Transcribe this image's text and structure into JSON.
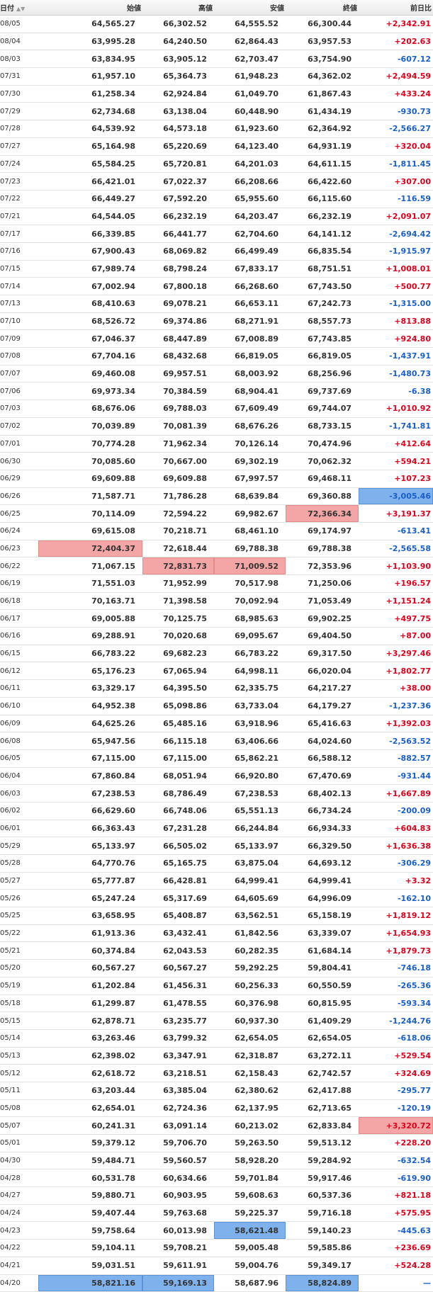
{
  "headers": {
    "date": "日付",
    "open": "始値",
    "high": "高値",
    "low": "安値",
    "close": "終値",
    "change": "前日比"
  },
  "colors": {
    "positive": "#e0001b",
    "negative": "#1a5fc8",
    "highlight_red": "#f4a6a6",
    "highlight_blue": "#7fb1ec"
  },
  "rows": [
    {
      "date": "08/05",
      "open": "64,565.27",
      "high": "66,302.52",
      "low": "64,555.52",
      "close": "66,300.44",
      "change": "+2,342.91"
    },
    {
      "date": "08/04",
      "open": "63,995.28",
      "high": "64,240.50",
      "low": "62,864.43",
      "close": "63,957.53",
      "change": "+202.63"
    },
    {
      "date": "08/03",
      "open": "63,834.95",
      "high": "63,905.12",
      "low": "62,703.47",
      "close": "63,754.90",
      "change": "-607.12"
    },
    {
      "date": "07/31",
      "open": "61,957.10",
      "high": "65,364.73",
      "low": "61,948.23",
      "close": "64,362.02",
      "change": "+2,494.59"
    },
    {
      "date": "07/30",
      "open": "61,258.34",
      "high": "62,924.84",
      "low": "61,049.70",
      "close": "61,867.43",
      "change": "+433.24"
    },
    {
      "date": "07/29",
      "open": "62,734.68",
      "high": "63,138.04",
      "low": "60,448.90",
      "close": "61,434.19",
      "change": "-930.73"
    },
    {
      "date": "07/28",
      "open": "64,539.92",
      "high": "64,573.18",
      "low": "61,923.60",
      "close": "62,364.92",
      "change": "-2,566.27"
    },
    {
      "date": "07/27",
      "open": "65,164.98",
      "high": "65,220.69",
      "low": "64,123.40",
      "close": "64,931.19",
      "change": "+320.04"
    },
    {
      "date": "07/24",
      "open": "65,584.25",
      "high": "65,720.81",
      "low": "64,201.03",
      "close": "64,611.15",
      "change": "-1,811.45"
    },
    {
      "date": "07/23",
      "open": "66,421.01",
      "high": "67,022.37",
      "low": "66,208.66",
      "close": "66,422.60",
      "change": "+307.00"
    },
    {
      "date": "07/22",
      "open": "66,449.27",
      "high": "67,592.20",
      "low": "65,955.60",
      "close": "66,115.60",
      "change": "-116.59"
    },
    {
      "date": "07/21",
      "open": "64,544.05",
      "high": "66,232.19",
      "low": "64,203.47",
      "close": "66,232.19",
      "change": "+2,091.07"
    },
    {
      "date": "07/17",
      "open": "66,339.85",
      "high": "66,441.77",
      "low": "62,704.60",
      "close": "64,141.12",
      "change": "-2,694.42"
    },
    {
      "date": "07/16",
      "open": "67,900.43",
      "high": "68,069.82",
      "low": "66,499.49",
      "close": "66,835.54",
      "change": "-1,915.97"
    },
    {
      "date": "07/15",
      "open": "67,989.74",
      "high": "68,798.24",
      "low": "67,833.17",
      "close": "68,751.51",
      "change": "+1,008.01"
    },
    {
      "date": "07/14",
      "open": "67,002.94",
      "high": "67,800.18",
      "low": "66,268.60",
      "close": "67,743.50",
      "change": "+500.77"
    },
    {
      "date": "07/13",
      "open": "68,410.63",
      "high": "69,078.21",
      "low": "66,653.11",
      "close": "67,242.73",
      "change": "-1,315.00"
    },
    {
      "date": "07/10",
      "open": "68,526.72",
      "high": "69,374.86",
      "low": "68,271.91",
      "close": "68,557.73",
      "change": "+813.88"
    },
    {
      "date": "07/09",
      "open": "67,046.37",
      "high": "68,447.89",
      "low": "67,008.89",
      "close": "67,743.85",
      "change": "+924.80"
    },
    {
      "date": "07/08",
      "open": "67,704.16",
      "high": "68,432.68",
      "low": "66,819.05",
      "close": "66,819.05",
      "change": "-1,437.91"
    },
    {
      "date": "07/07",
      "open": "69,460.08",
      "high": "69,957.51",
      "low": "68,003.92",
      "close": "68,256.96",
      "change": "-1,480.73"
    },
    {
      "date": "07/06",
      "open": "69,973.34",
      "high": "70,384.59",
      "low": "68,904.41",
      "close": "69,737.69",
      "change": "-6.38"
    },
    {
      "date": "07/03",
      "open": "68,676.06",
      "high": "69,788.03",
      "low": "67,609.49",
      "close": "69,744.07",
      "change": "+1,010.92"
    },
    {
      "date": "07/02",
      "open": "70,039.89",
      "high": "70,081.39",
      "low": "68,676.26",
      "close": "68,733.15",
      "change": "-1,741.81"
    },
    {
      "date": "07/01",
      "open": "70,774.28",
      "high": "71,962.34",
      "low": "70,126.14",
      "close": "70,474.96",
      "change": "+412.64"
    },
    {
      "date": "06/30",
      "open": "70,085.60",
      "high": "70,667.00",
      "low": "69,302.19",
      "close": "70,062.32",
      "change": "+594.21"
    },
    {
      "date": "06/29",
      "open": "69,609.88",
      "high": "69,609.88",
      "low": "67,997.57",
      "close": "69,468.11",
      "change": "+107.23"
    },
    {
      "date": "06/26",
      "open": "71,587.71",
      "high": "71,786.28",
      "low": "68,639.84",
      "close": "69,360.88",
      "change": "-3,005.46",
      "hl_change": "blue"
    },
    {
      "date": "06/25",
      "open": "70,114.09",
      "high": "72,594.22",
      "low": "69,982.67",
      "close": "72,366.34",
      "change": "+3,191.37",
      "hl_close": "red"
    },
    {
      "date": "06/24",
      "open": "69,615.08",
      "high": "70,218.71",
      "low": "68,461.10",
      "close": "69,174.97",
      "change": "-613.41"
    },
    {
      "date": "06/23",
      "open": "72,404.37",
      "high": "72,618.44",
      "low": "69,788.38",
      "close": "69,788.38",
      "change": "-2,565.58",
      "hl_open": "red"
    },
    {
      "date": "06/22",
      "open": "71,067.15",
      "high": "72,831.73",
      "low": "71,009.52",
      "close": "72,353.96",
      "change": "+1,103.90",
      "hl_high": "red",
      "hl_low": "red"
    },
    {
      "date": "06/19",
      "open": "71,551.03",
      "high": "71,952.99",
      "low": "70,517.98",
      "close": "71,250.06",
      "change": "+196.57"
    },
    {
      "date": "06/18",
      "open": "70,163.71",
      "high": "71,398.58",
      "low": "70,092.94",
      "close": "71,053.49",
      "change": "+1,151.24"
    },
    {
      "date": "06/17",
      "open": "69,005.88",
      "high": "70,125.75",
      "low": "68,985.63",
      "close": "69,902.25",
      "change": "+497.75"
    },
    {
      "date": "06/16",
      "open": "69,288.91",
      "high": "70,020.68",
      "low": "69,095.67",
      "close": "69,404.50",
      "change": "+87.00"
    },
    {
      "date": "06/15",
      "open": "66,783.22",
      "high": "69,682.23",
      "low": "66,783.22",
      "close": "69,317.50",
      "change": "+3,297.46"
    },
    {
      "date": "06/12",
      "open": "65,176.23",
      "high": "67,065.94",
      "low": "64,998.11",
      "close": "66,020.04",
      "change": "+1,802.77"
    },
    {
      "date": "06/11",
      "open": "63,329.17",
      "high": "64,395.50",
      "low": "62,335.75",
      "close": "64,217.27",
      "change": "+38.00"
    },
    {
      "date": "06/10",
      "open": "64,952.38",
      "high": "65,098.86",
      "low": "63,733.04",
      "close": "64,179.27",
      "change": "-1,237.36"
    },
    {
      "date": "06/09",
      "open": "64,625.26",
      "high": "65,485.16",
      "low": "63,918.96",
      "close": "65,416.63",
      "change": "+1,392.03"
    },
    {
      "date": "06/08",
      "open": "65,947.56",
      "high": "66,115.18",
      "low": "63,406.66",
      "close": "64,024.60",
      "change": "-2,563.52"
    },
    {
      "date": "06/05",
      "open": "67,115.00",
      "high": "67,115.00",
      "low": "65,862.21",
      "close": "66,588.12",
      "change": "-882.57"
    },
    {
      "date": "06/04",
      "open": "67,860.84",
      "high": "68,051.94",
      "low": "66,920.80",
      "close": "67,470.69",
      "change": "-931.44"
    },
    {
      "date": "06/03",
      "open": "67,238.53",
      "high": "68,786.49",
      "low": "67,238.53",
      "close": "68,402.13",
      "change": "+1,667.89"
    },
    {
      "date": "06/02",
      "open": "66,629.60",
      "high": "66,748.06",
      "low": "65,551.13",
      "close": "66,734.24",
      "change": "-200.09"
    },
    {
      "date": "06/01",
      "open": "66,363.43",
      "high": "67,231.28",
      "low": "66,244.84",
      "close": "66,934.33",
      "change": "+604.83"
    },
    {
      "date": "05/29",
      "open": "65,133.97",
      "high": "66,505.02",
      "low": "65,133.97",
      "close": "66,329.50",
      "change": "+1,636.38"
    },
    {
      "date": "05/28",
      "open": "64,770.76",
      "high": "65,165.75",
      "low": "63,875.04",
      "close": "64,693.12",
      "change": "-306.29"
    },
    {
      "date": "05/27",
      "open": "65,777.87",
      "high": "66,428.81",
      "low": "64,999.41",
      "close": "64,999.41",
      "change": "+3.32"
    },
    {
      "date": "05/26",
      "open": "65,247.24",
      "high": "65,317.69",
      "low": "64,605.69",
      "close": "64,996.09",
      "change": "-162.10"
    },
    {
      "date": "05/25",
      "open": "63,658.95",
      "high": "65,408.87",
      "low": "63,562.51",
      "close": "65,158.19",
      "change": "+1,819.12"
    },
    {
      "date": "05/22",
      "open": "61,913.36",
      "high": "63,432.41",
      "low": "61,842.56",
      "close": "63,339.07",
      "change": "+1,654.93"
    },
    {
      "date": "05/21",
      "open": "60,374.84",
      "high": "62,043.53",
      "low": "60,282.35",
      "close": "61,684.14",
      "change": "+1,879.73"
    },
    {
      "date": "05/20",
      "open": "60,567.27",
      "high": "60,567.27",
      "low": "59,292.25",
      "close": "59,804.41",
      "change": "-746.18"
    },
    {
      "date": "05/19",
      "open": "61,202.84",
      "high": "61,456.31",
      "low": "60,256.33",
      "close": "60,550.59",
      "change": "-265.36"
    },
    {
      "date": "05/18",
      "open": "61,299.87",
      "high": "61,478.55",
      "low": "60,376.98",
      "close": "60,815.95",
      "change": "-593.34"
    },
    {
      "date": "05/15",
      "open": "62,878.71",
      "high": "63,235.77",
      "low": "60,937.30",
      "close": "61,409.29",
      "change": "-1,244.76"
    },
    {
      "date": "05/14",
      "open": "63,263.46",
      "high": "63,799.32",
      "low": "62,654.05",
      "close": "62,654.05",
      "change": "-618.06"
    },
    {
      "date": "05/13",
      "open": "62,398.02",
      "high": "63,347.91",
      "low": "62,318.87",
      "close": "63,272.11",
      "change": "+529.54"
    },
    {
      "date": "05/12",
      "open": "62,618.72",
      "high": "63,218.51",
      "low": "62,158.43",
      "close": "62,742.57",
      "change": "+324.69"
    },
    {
      "date": "05/11",
      "open": "63,203.44",
      "high": "63,385.04",
      "low": "62,380.62",
      "close": "62,417.88",
      "change": "-295.77"
    },
    {
      "date": "05/08",
      "open": "62,654.01",
      "high": "62,724.36",
      "low": "62,137.95",
      "close": "62,713.65",
      "change": "-120.19"
    },
    {
      "date": "05/07",
      "open": "60,241.31",
      "high": "63,091.14",
      "low": "60,213.02",
      "close": "62,833.84",
      "change": "+3,320.72",
      "hl_change": "red"
    },
    {
      "date": "05/01",
      "open": "59,379.12",
      "high": "59,706.70",
      "low": "59,263.50",
      "close": "59,513.12",
      "change": "+228.20"
    },
    {
      "date": "04/30",
      "open": "59,484.71",
      "high": "59,560.57",
      "low": "58,928.20",
      "close": "59,284.92",
      "change": "-632.54"
    },
    {
      "date": "04/28",
      "open": "60,531.78",
      "high": "60,634.66",
      "low": "59,701.84",
      "close": "59,917.46",
      "change": "-619.90"
    },
    {
      "date": "04/27",
      "open": "59,880.71",
      "high": "60,903.95",
      "low": "59,608.63",
      "close": "60,537.36",
      "change": "+821.18"
    },
    {
      "date": "04/24",
      "open": "59,407.44",
      "high": "59,763.68",
      "low": "59,225.37",
      "close": "59,716.18",
      "change": "+575.95"
    },
    {
      "date": "04/23",
      "open": "59,758.64",
      "high": "60,013.98",
      "low": "58,621.48",
      "close": "59,140.23",
      "change": "-445.63",
      "hl_low": "blue"
    },
    {
      "date": "04/22",
      "open": "59,104.11",
      "high": "59,708.21",
      "low": "59,005.48",
      "close": "59,585.86",
      "change": "+236.69"
    },
    {
      "date": "04/21",
      "open": "59,031.51",
      "high": "59,611.91",
      "low": "59,004.76",
      "close": "59,349.17",
      "change": "+524.28"
    },
    {
      "date": "04/20",
      "open": "58,821.16",
      "high": "59,169.13",
      "low": "58,687.96",
      "close": "58,824.89",
      "change": "—",
      "hl_open": "blue",
      "hl_high": "blue",
      "hl_close": "blue"
    }
  ]
}
